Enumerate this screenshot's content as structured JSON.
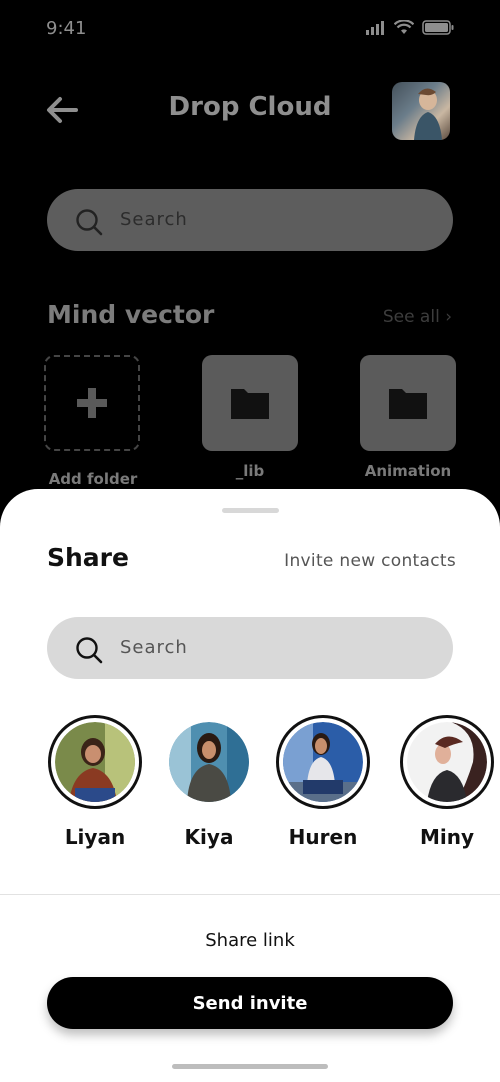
{
  "status": {
    "time": "9:41"
  },
  "header": {
    "title": "Drop Cloud"
  },
  "search_top": {
    "placeholder": "Search"
  },
  "section": {
    "title": "Mind vector",
    "see_all": "See all ›",
    "folders": [
      {
        "label": "Add folder"
      },
      {
        "label": "_lib"
      },
      {
        "label": "Animation"
      }
    ]
  },
  "sheet": {
    "title": "Share",
    "invite_label": "Invite new contacts",
    "search_placeholder": "Search",
    "contacts": [
      {
        "name": "Liyan"
      },
      {
        "name": "Kiya"
      },
      {
        "name": "Huren"
      },
      {
        "name": "Miny"
      }
    ],
    "share_link_label": "Share link",
    "send_label": "Send invite"
  },
  "icons": [
    "back-arrow-icon",
    "search-icon",
    "plus-icon",
    "folder-icon",
    "signal-icon",
    "wifi-icon",
    "battery-icon"
  ]
}
